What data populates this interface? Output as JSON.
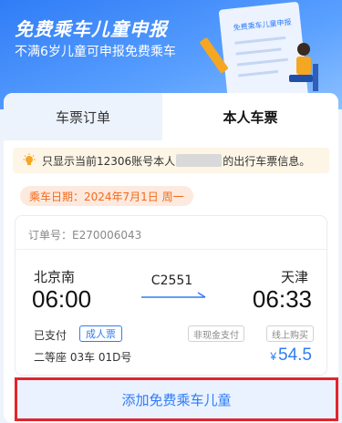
{
  "banner": {
    "title": "免费乘车儿童申报",
    "subtitle": "不满6岁儿童可申报免费乘车",
    "document_label": "免费乘车儿童申报"
  },
  "tabs": [
    {
      "label": "车票订单",
      "active": false
    },
    {
      "label": "本人车票",
      "active": true
    }
  ],
  "notice": {
    "prefix": "只显示当前12306账号本人",
    "suffix": "的出行车票信息。"
  },
  "travel_date": "乘车日期：2024年7月1日 周一",
  "ticket": {
    "order_no": "订单号：E270006043",
    "from_station": "北京南",
    "to_station": "天津",
    "departure_time": "06:00",
    "arrival_time": "06:33",
    "train_no": "C2551",
    "payment_status": "已支付",
    "ticket_type": "成人票",
    "payment_method": "非现金支付",
    "purchase_channel": "线上购买",
    "seat": "二等座 03车 01D号",
    "currency_symbol": "¥",
    "price": "54.5"
  },
  "add_child_button": "添加免费乘车儿童",
  "colors": {
    "accent": "#2f7cf6",
    "orange": "#f26a1b",
    "highlight_border": "#e3242b"
  }
}
